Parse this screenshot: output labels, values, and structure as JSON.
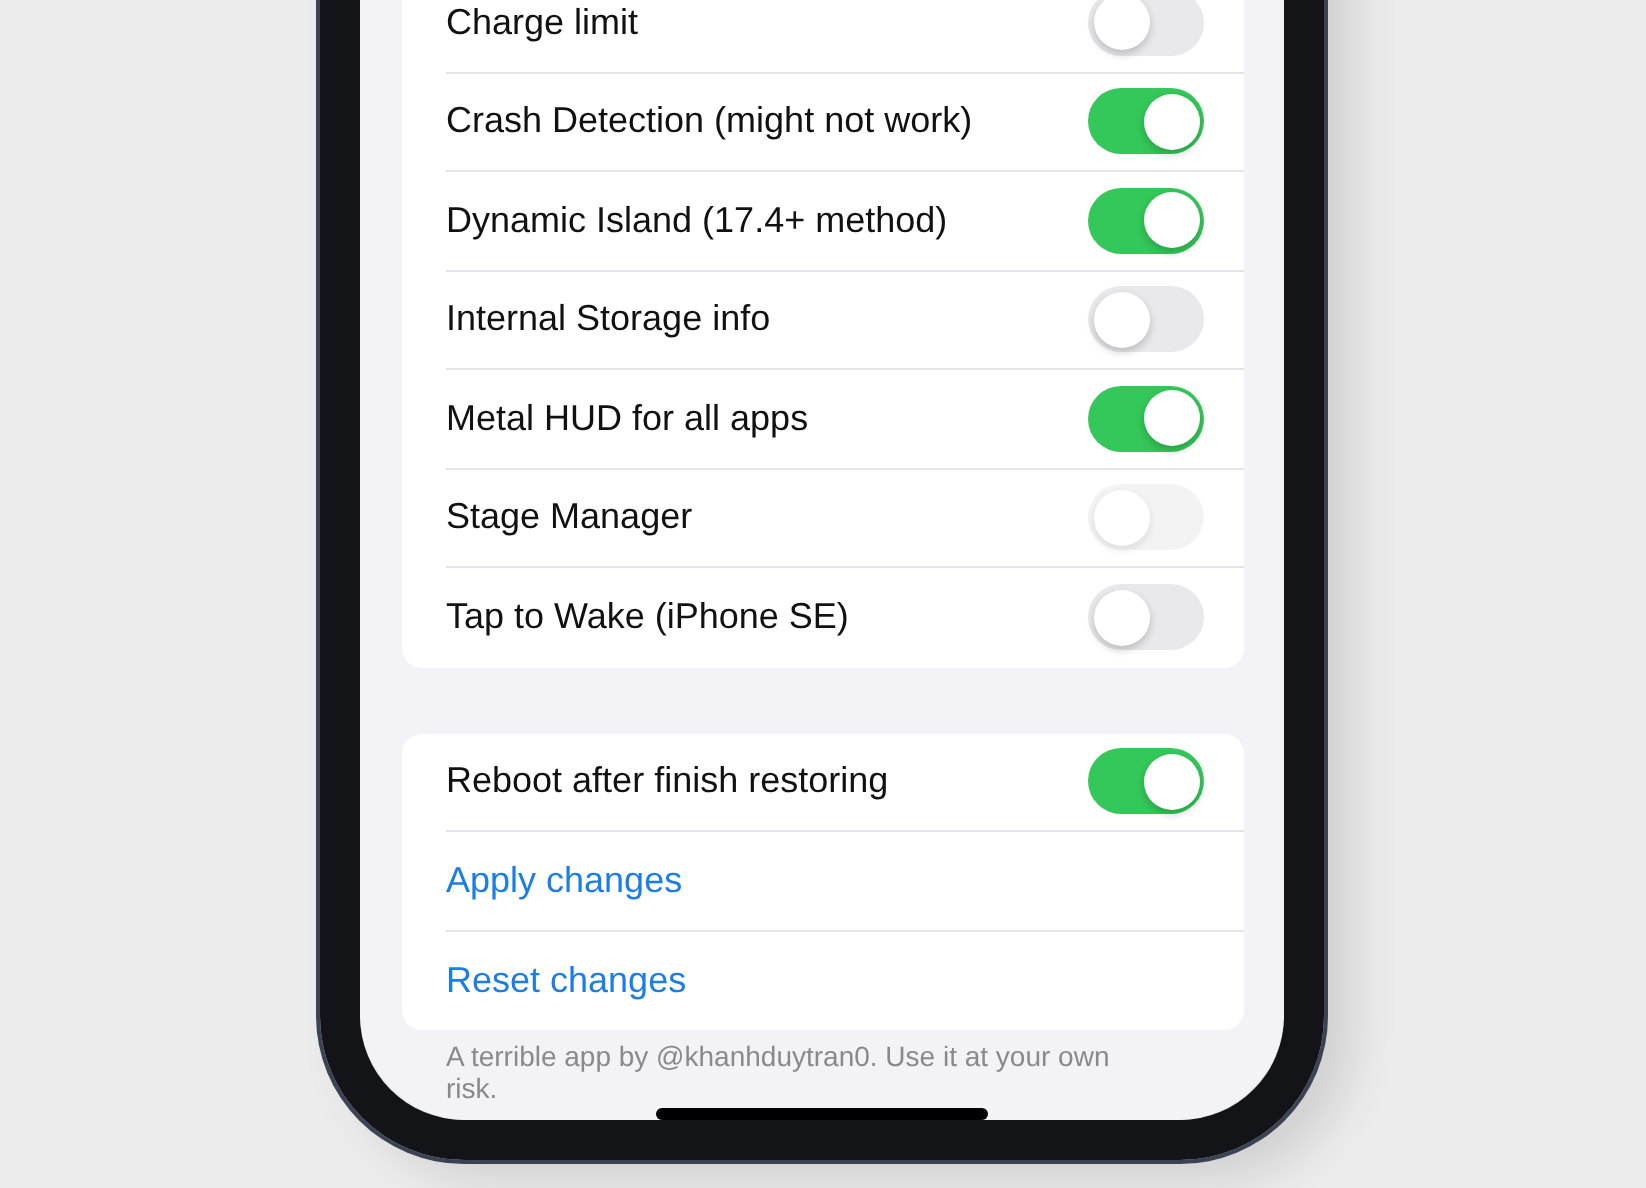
{
  "sections": [
    {
      "rows": [
        {
          "kind": "toggle",
          "label": "Charge limit",
          "on": false,
          "disabled": false
        },
        {
          "kind": "toggle",
          "label": "Crash Detection (might not work)",
          "on": true,
          "disabled": false
        },
        {
          "kind": "toggle",
          "label": "Dynamic Island (17.4+ method)",
          "on": true,
          "disabled": false
        },
        {
          "kind": "toggle",
          "label": "Internal Storage info",
          "on": false,
          "disabled": false
        },
        {
          "kind": "toggle",
          "label": "Metal HUD for all apps",
          "on": true,
          "disabled": false
        },
        {
          "kind": "toggle",
          "label": "Stage Manager",
          "on": false,
          "disabled": true
        },
        {
          "kind": "toggle",
          "label": "Tap to Wake (iPhone SE)",
          "on": false,
          "disabled": false
        }
      ]
    },
    {
      "rows": [
        {
          "kind": "toggle",
          "label": "Reboot after finish restoring",
          "on": true,
          "disabled": false
        },
        {
          "kind": "action",
          "label": "Apply changes"
        },
        {
          "kind": "action",
          "label": "Reset changes"
        }
      ]
    }
  ],
  "footer": "A terrible app by @khanhduytran0. Use it at your own risk."
}
